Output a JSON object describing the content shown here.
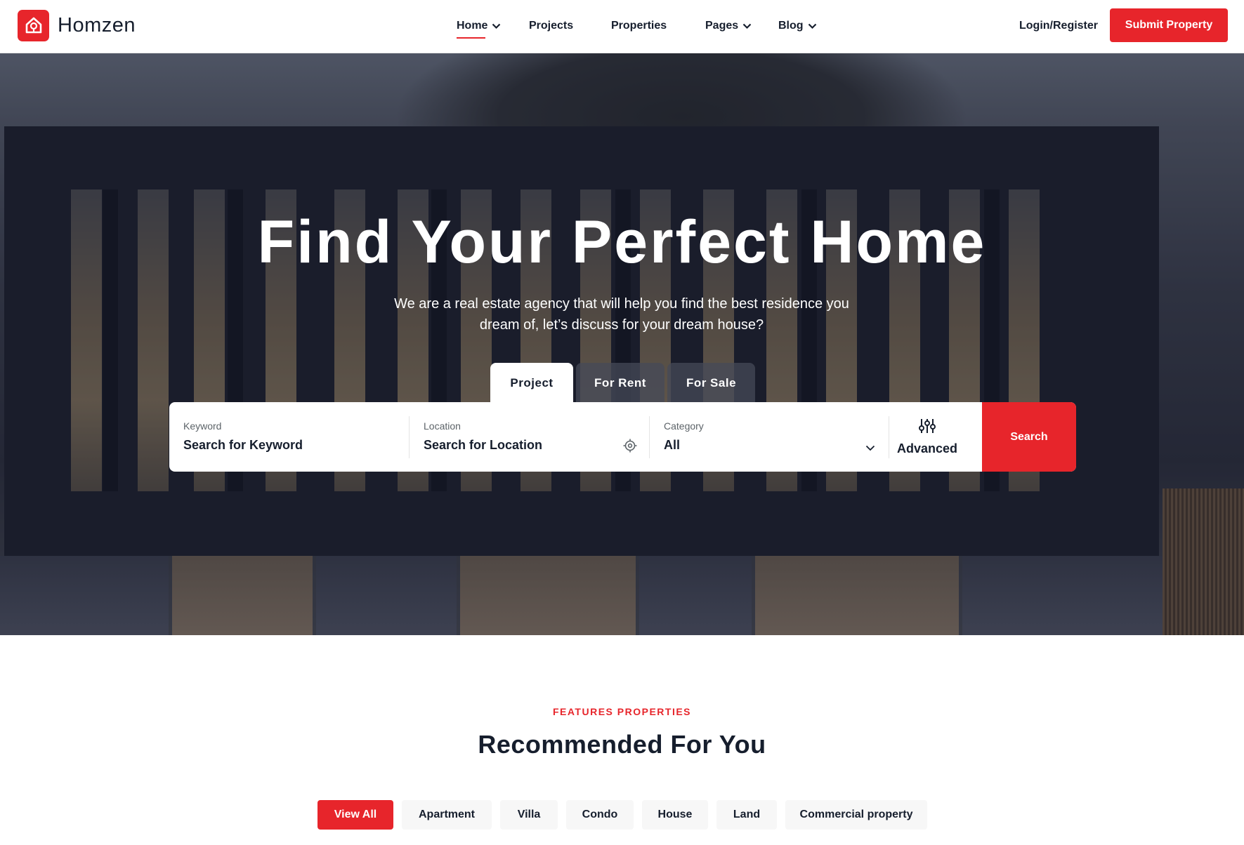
{
  "header": {
    "brand": "Homzen",
    "nav": [
      {
        "label": "Home",
        "has_dropdown": true,
        "active": true
      },
      {
        "label": "Projects",
        "has_dropdown": false
      },
      {
        "label": "Properties",
        "has_dropdown": false
      },
      {
        "label": "Pages",
        "has_dropdown": true
      },
      {
        "label": "Blog",
        "has_dropdown": true
      }
    ],
    "login_label": "Login/Register",
    "submit_label": "Submit Property"
  },
  "hero": {
    "title": "Find Your Perfect Home",
    "subtitle": "We are a real estate agency that will help you find the best residence you dream of, let’s discuss for your dream house?",
    "tabs": [
      {
        "label": "Project",
        "active": true
      },
      {
        "label": "For Rent"
      },
      {
        "label": "For Sale"
      }
    ],
    "search": {
      "keyword": {
        "label": "Keyword",
        "placeholder": "Search for Keyword"
      },
      "location": {
        "label": "Location",
        "placeholder": "Search for Location"
      },
      "category": {
        "label": "Category",
        "value": "All"
      },
      "advanced_label": "Advanced",
      "search_label": "Search"
    }
  },
  "features": {
    "eyebrow": "FEATURES PROPERTIES",
    "title": "Recommended For You",
    "filters": [
      {
        "label": "View All",
        "active": true
      },
      {
        "label": "Apartment"
      },
      {
        "label": "Villa"
      },
      {
        "label": "Condo"
      },
      {
        "label": "House"
      },
      {
        "label": "Land"
      },
      {
        "label": "Commercial property"
      }
    ]
  },
  "colors": {
    "accent": "#e7252b",
    "text": "#161e2d",
    "chip_bg": "#f7f7f7"
  },
  "icons": [
    "home-logo-icon",
    "chevron-down-icon",
    "location-target-icon",
    "sliders-icon"
  ]
}
